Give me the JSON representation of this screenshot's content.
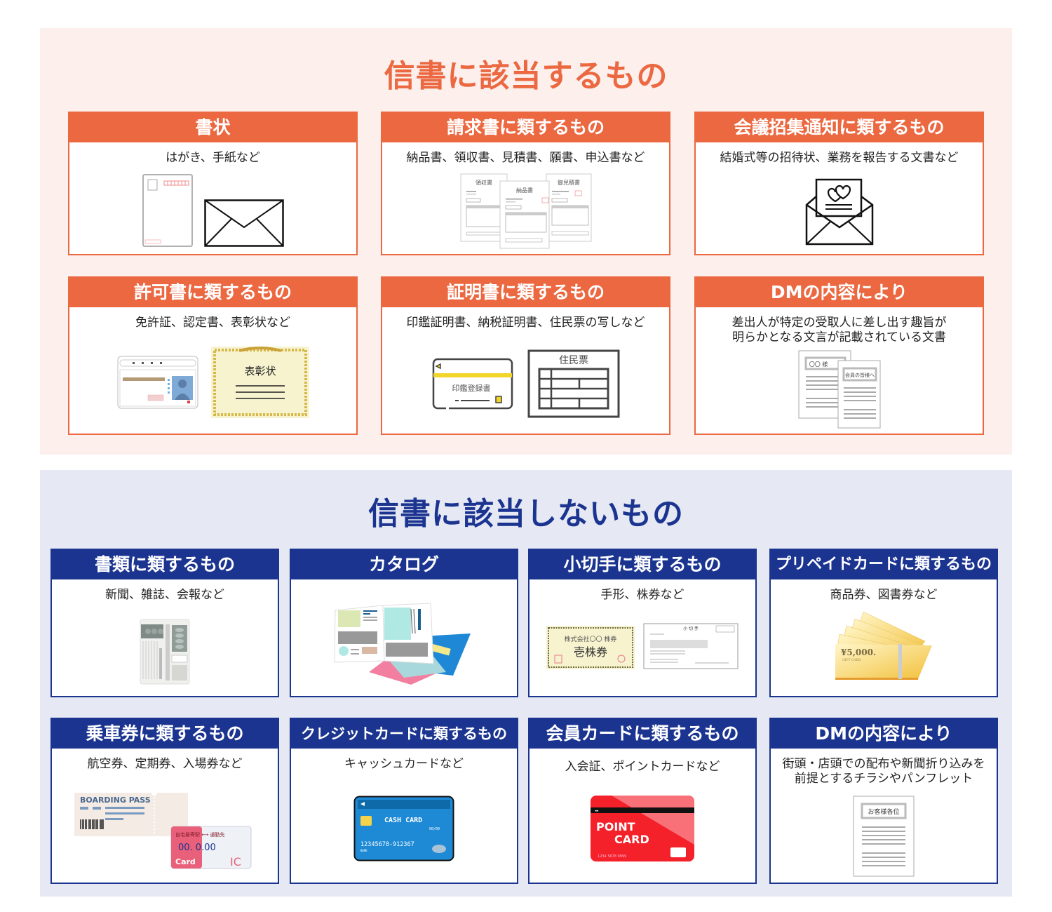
{
  "top_section": {
    "title": "信書に該当するもの",
    "accent_color": "#eb6841",
    "background_color": "#fcefec",
    "cards": [
      {
        "title": "書状",
        "description": "はがき、手紙など",
        "icons": [
          "postcard-icon",
          "envelope-icon"
        ]
      },
      {
        "title": "請求書に類するもの",
        "description": "納品書、領収書、見積書、願書、申込書など",
        "icons": [
          "invoice-documents-icon"
        ],
        "doc_labels": [
          "領収書",
          "納品書",
          "御見積書"
        ]
      },
      {
        "title": "会議招集通知に類するもの",
        "description": "結婚式等の招待状、業務を報告する文書など",
        "icons": [
          "invitation-envelope-icon"
        ]
      },
      {
        "title": "許可書に類するもの",
        "description": "免許証、認定書、表彰状など",
        "icons": [
          "license-card-icon",
          "certificate-icon"
        ],
        "certificate_label": "表彰状"
      },
      {
        "title": "証明書に類するもの",
        "description": "印鑑証明書、納税証明書、住民票の写しなど",
        "icons": [
          "seal-registration-card-icon",
          "resident-record-icon"
        ],
        "card_label": "印鑑登録書",
        "record_label": "住民票"
      },
      {
        "title": "DMの内容により",
        "description": "差出人が特定の受取人に差し出す趣旨が\n明らかとなる文言が記載されている文書",
        "icons": [
          "addressed-dm-icon"
        ],
        "doc_labels": [
          "〇〇 様",
          "会員の皆様へ"
        ]
      }
    ]
  },
  "bottom_section": {
    "title": "信書に該当しないもの",
    "accent_color": "#1b3490",
    "background_color": "#e6e9f4",
    "cards": [
      {
        "title": "書類に類するもの",
        "description": "新聞、雑誌、会報など",
        "icons": [
          "newspaper-icon"
        ]
      },
      {
        "title": "カタログ",
        "description": "",
        "icons": [
          "catalog-icon"
        ]
      },
      {
        "title": "小切手に類するもの",
        "description": "手形、株券など",
        "icons": [
          "stock-certificate-icon",
          "check-icon"
        ],
        "stock_labels": [
          "株式会社〇〇 株券",
          "壱株券"
        ],
        "check_label": "小 切 手"
      },
      {
        "title": "プリペイドカードに類するもの",
        "description": "商品券、図書券など",
        "icons": [
          "gift-card-icon"
        ],
        "gift_labels": [
          "¥5,000.",
          "GIFT CARD"
        ]
      },
      {
        "title": "乗車券に類するもの",
        "description": "航空券、定期券、入場券など",
        "icons": [
          "boarding-pass-icon",
          "ic-card-icon"
        ],
        "pass_label": "BOARDING PASS",
        "ic_labels": [
          "自宅最寄駅 ⟷ 通勤先",
          "00. 0.00",
          "Card",
          "IC"
        ]
      },
      {
        "title": "クレジットカードに類するもの",
        "description": "キャッシュカードなど",
        "icons": [
          "cash-card-icon"
        ],
        "card_labels": [
          "CASH CARD",
          "00/00",
          "12345678-912367",
          "NAME"
        ]
      },
      {
        "title": "会員カードに類するもの",
        "description": "入会証、ポイントカードなど",
        "icons": [
          "point-card-icon"
        ],
        "card_labels": [
          "POINT",
          "CARD",
          "1234 5678 9999"
        ]
      },
      {
        "title": "DMの内容により",
        "description": "街頭・店頭での配布や新聞折り込みを\n前提とするチラシやパンフレット",
        "icons": [
          "flyer-icon"
        ],
        "doc_label": "お客様各位"
      }
    ]
  }
}
